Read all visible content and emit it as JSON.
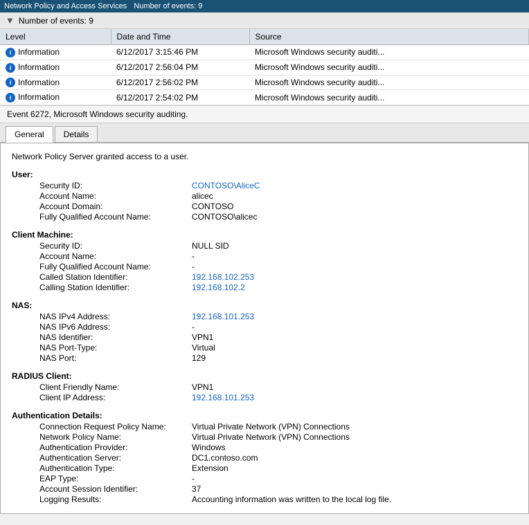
{
  "titleBar": {
    "appName": "Network Policy and Access Services",
    "eventCount": "Number of events: 9"
  },
  "filterBar": {
    "label": "Number of events: 9"
  },
  "table": {
    "columns": [
      "Level",
      "Date and Time",
      "Source"
    ],
    "rows": [
      {
        "level": "Information",
        "datetime": "6/12/2017 3:15:46 PM",
        "source": "Microsoft Windows security auditi..."
      },
      {
        "level": "Information",
        "datetime": "6/12/2017 2:56:04 PM",
        "source": "Microsoft Windows security auditi..."
      },
      {
        "level": "Information",
        "datetime": "6/12/2017 2:56:02 PM",
        "source": "Microsoft Windows security auditi..."
      },
      {
        "level": "Information",
        "datetime": "6/12/2017 2:54:02 PM",
        "source": "Microsoft Windows security auditi..."
      }
    ]
  },
  "eventSummary": "Event 6272, Microsoft Windows security auditing.",
  "tabs": [
    "General",
    "Details"
  ],
  "activeTab": "General",
  "detail": {
    "heading": "Network Policy Server granted access to a user.",
    "sections": [
      {
        "label": "User:",
        "fields": [
          {
            "name": "Security ID:",
            "value": "CONTOSO\\AliceC",
            "style": "link"
          },
          {
            "name": "Account Name:",
            "value": "alicec",
            "style": "black"
          },
          {
            "name": "Account Domain:",
            "value": "CONTOSO",
            "style": "black"
          },
          {
            "name": "Fully Qualified Account Name:",
            "value": "CONTOSO\\alicec",
            "style": "black"
          }
        ]
      },
      {
        "label": "Client Machine:",
        "fields": [
          {
            "name": "Security ID:",
            "value": "NULL SID",
            "style": "black"
          },
          {
            "name": "Account Name:",
            "value": "-",
            "style": "black"
          },
          {
            "name": "Fully Qualified Account Name:",
            "value": "-",
            "style": "black"
          },
          {
            "name": "Called Station Identifier:",
            "value": "192.168.102.253",
            "style": "link"
          },
          {
            "name": "Calling Station Identifier:",
            "value": "192.168.102.2",
            "style": "link"
          }
        ]
      },
      {
        "label": "NAS:",
        "fields": [
          {
            "name": "NAS IPv4 Address:",
            "value": "192.168.101.253",
            "style": "link"
          },
          {
            "name": "NAS IPv6 Address:",
            "value": "-",
            "style": "black"
          },
          {
            "name": "NAS Identifier:",
            "value": "VPN1",
            "style": "black"
          },
          {
            "name": "NAS Port-Type:",
            "value": "Virtual",
            "style": "black"
          },
          {
            "name": "NAS Port:",
            "value": "129",
            "style": "black"
          }
        ]
      },
      {
        "label": "RADIUS Client:",
        "fields": [
          {
            "name": "Client Friendly Name:",
            "value": "VPN1",
            "style": "black"
          },
          {
            "name": "Client IP Address:",
            "value": "192.168.101.253",
            "style": "link"
          }
        ]
      },
      {
        "label": "Authentication Details:",
        "fields": [
          {
            "name": "Connection Request Policy Name:",
            "value": "Virtual Private Network (VPN) Connections",
            "style": "black"
          },
          {
            "name": "Network Policy Name:",
            "value": "Virtual Private Network (VPN) Connections",
            "style": "black"
          },
          {
            "name": "Authentication Provider:",
            "value": "Windows",
            "style": "black"
          },
          {
            "name": "Authentication Server:",
            "value": "DC1.contoso.com",
            "style": "black"
          },
          {
            "name": "Authentication Type:",
            "value": "Extension",
            "style": "black"
          },
          {
            "name": "EAP Type:",
            "value": "-",
            "style": "black"
          },
          {
            "name": "Account Session Identifier:",
            "value": "37",
            "style": "black"
          },
          {
            "name": "Logging Results:",
            "value": "Accounting information was written to the local log file.",
            "style": "black"
          }
        ]
      }
    ]
  }
}
